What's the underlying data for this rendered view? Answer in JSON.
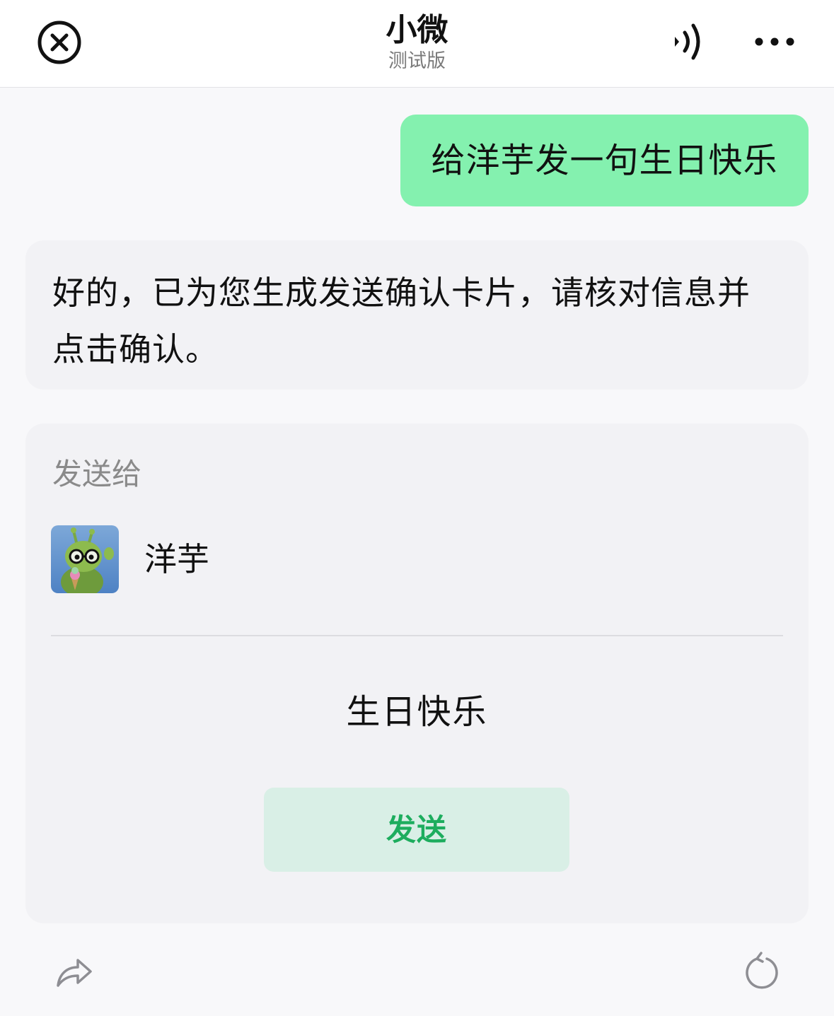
{
  "header": {
    "close_icon": "close-circle-icon",
    "title": "小微",
    "subtitle": "测试版",
    "voice_icon": "speaker-icon",
    "more_icon": "more-dots-icon"
  },
  "conversation": {
    "user_message": "给洋芋发一句生日快乐",
    "assistant_reply": "好的，已为您生成发送确认卡片，请核对信息并点击确认。"
  },
  "confirm_card": {
    "label": "发送给",
    "recipient": {
      "name": "洋芋",
      "avatar": "cartoon-alien-with-glasses-avatar"
    },
    "message": "生日快乐",
    "send_label": "发送"
  },
  "actions": {
    "share_icon": "share-arrow-icon",
    "refresh_icon": "refresh-icon"
  },
  "colors": {
    "user_bubble": "#84F1AF",
    "assistant_bubble": "#F2F2F5",
    "send_button_bg": "#D9EFE6",
    "send_button_text": "#1DAD5E"
  }
}
